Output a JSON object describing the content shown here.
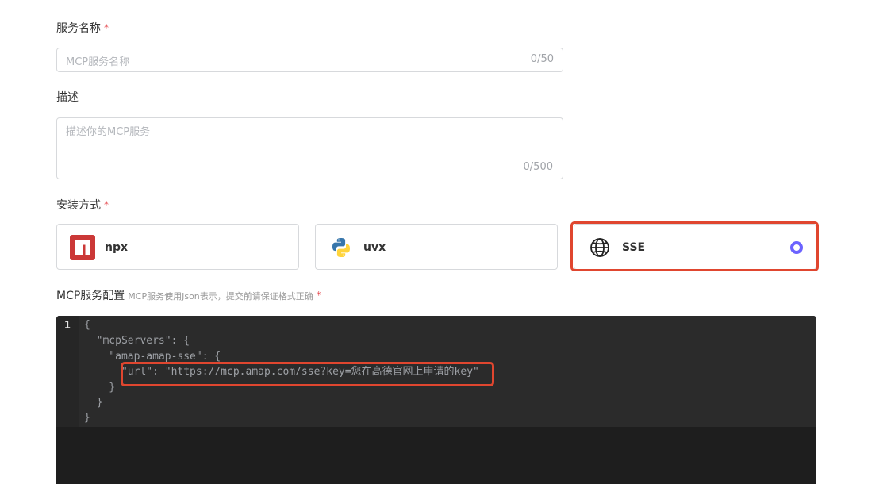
{
  "form": {
    "service_name": {
      "label": "服务名称",
      "required_mark": "*",
      "placeholder": "MCP服务名称",
      "counter": "0/50"
    },
    "description": {
      "label": "描述",
      "placeholder": "描述你的MCP服务",
      "counter": "0/500"
    },
    "install_method": {
      "label": "安装方式",
      "required_mark": "*",
      "options": [
        {
          "label": "npx",
          "icon": "npm-icon",
          "selected": false
        },
        {
          "label": "uvx",
          "icon": "python-icon",
          "selected": false
        },
        {
          "label": "SSE",
          "icon": "globe-icon",
          "selected": true
        }
      ]
    },
    "config": {
      "label": "MCP服务配置",
      "hint": "MCP服务使用Json表示，提交前请保证格式正确",
      "required_mark": "*",
      "line_number": "1",
      "code_lines": [
        "{",
        "  \"mcpServers\": {",
        "    \"amap-amap-sse\": {",
        "      \"url\": \"https://mcp.amap.com/sse?key=您在高德官网上申请的key\"",
        "    }",
        "  }",
        "}"
      ]
    }
  },
  "colors": {
    "accent": "#6c63ff",
    "highlight_border": "#e0462f",
    "required": "#e5484d",
    "npm_red": "#cb3837",
    "python_blue": "#3776ab",
    "python_yellow": "#ffd43b",
    "editor_bg": "#1e1e1e"
  }
}
